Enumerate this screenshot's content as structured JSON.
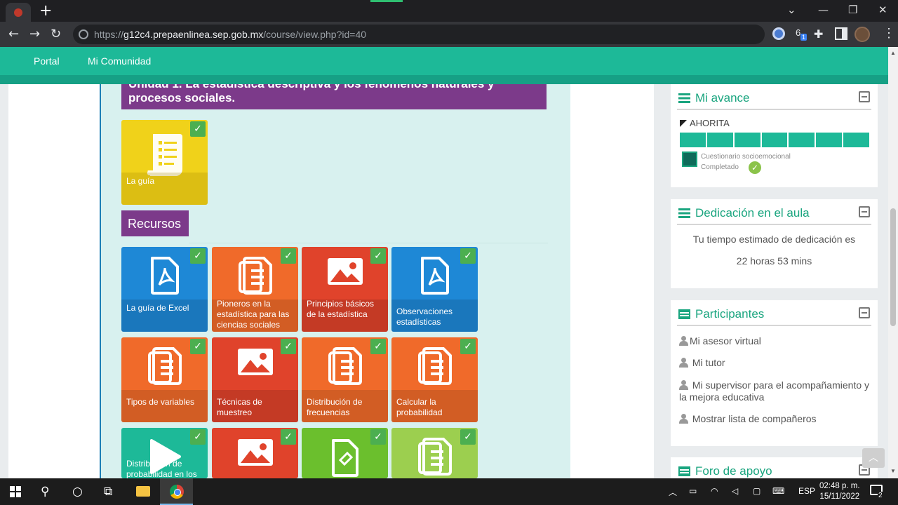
{
  "browser": {
    "url_scheme": "https://",
    "url_host": "g12c4.prepaenlinea.sep.gob.mx",
    "url_path": "/course/view.php?id=40",
    "extension_badge": "1"
  },
  "site_nav": {
    "items": [
      {
        "label": "Portal"
      },
      {
        "label": "Mi Comunidad"
      }
    ]
  },
  "course": {
    "unit_title": "Unidad 1. La estadística descriptiva y los fenómenos naturales y procesos sociales.",
    "guide_tile": {
      "label": "La guía",
      "color": "#f0d21a"
    },
    "resources_heading": "Recursos",
    "tiles": [
      {
        "label": "La guía de Excel",
        "color": "#1e88d6",
        "icon": "pdf-icon"
      },
      {
        "label": "Pioneros en la estadística para las ciencias sociales",
        "color": "#f06a2a",
        "icon": "document-icon"
      },
      {
        "label": "Principios básicos de la estadística",
        "color": "#e0432b",
        "icon": "image-icon"
      },
      {
        "label": "Observaciones estadísticas",
        "color": "#1e88d6",
        "icon": "pdf-icon"
      },
      {
        "label": "Tipos de variables",
        "color": "#f06a2a",
        "icon": "document-icon"
      },
      {
        "label": "Técnicas de muestreo",
        "color": "#e0432b",
        "icon": "image-icon"
      },
      {
        "label": "Distribución de frecuencias",
        "color": "#f06a2a",
        "icon": "document-icon"
      },
      {
        "label": "Calcular la probabilidad",
        "color": "#f06a2a",
        "icon": "document-icon"
      },
      {
        "label": "Distribución de probabilidad en los",
        "color": "#1db998",
        "icon": "play-icon"
      },
      {
        "label": "",
        "color": "#e0432b",
        "icon": "image-icon"
      },
      {
        "label": "",
        "color": "#6bbf2d",
        "icon": "file-edit-icon"
      },
      {
        "label": "",
        "color": "#9ccf4f",
        "icon": "document-icon"
      }
    ]
  },
  "sidebar": {
    "avance": {
      "title": "Mi avance",
      "current_label": "AHORITA",
      "progress_segments": 7,
      "progress_completed": 7,
      "activity_name": "Cuestionario socioemocional",
      "activity_status": "Completado"
    },
    "dedicacion": {
      "title": "Dedicación en el aula",
      "description": "Tu tiempo estimado de dedicación es",
      "time": "22 horas 53 mins"
    },
    "participantes": {
      "title": "Participantes",
      "links": [
        "Mi asesor virtual",
        "Mi tutor",
        "Mi supervisor para el acompañamiento y la mejora educativa",
        "Mostrar lista de compañeros"
      ]
    },
    "foro": {
      "title": "Foro de apoyo"
    }
  },
  "taskbar": {
    "language": "ESP",
    "time": "02:48 p. m.",
    "date": "15/11/2022",
    "notification_count": "2"
  },
  "colors": {
    "accent": "#1db998",
    "title_purple": "#7c3a8a",
    "course_bg": "#d8f1ef"
  }
}
